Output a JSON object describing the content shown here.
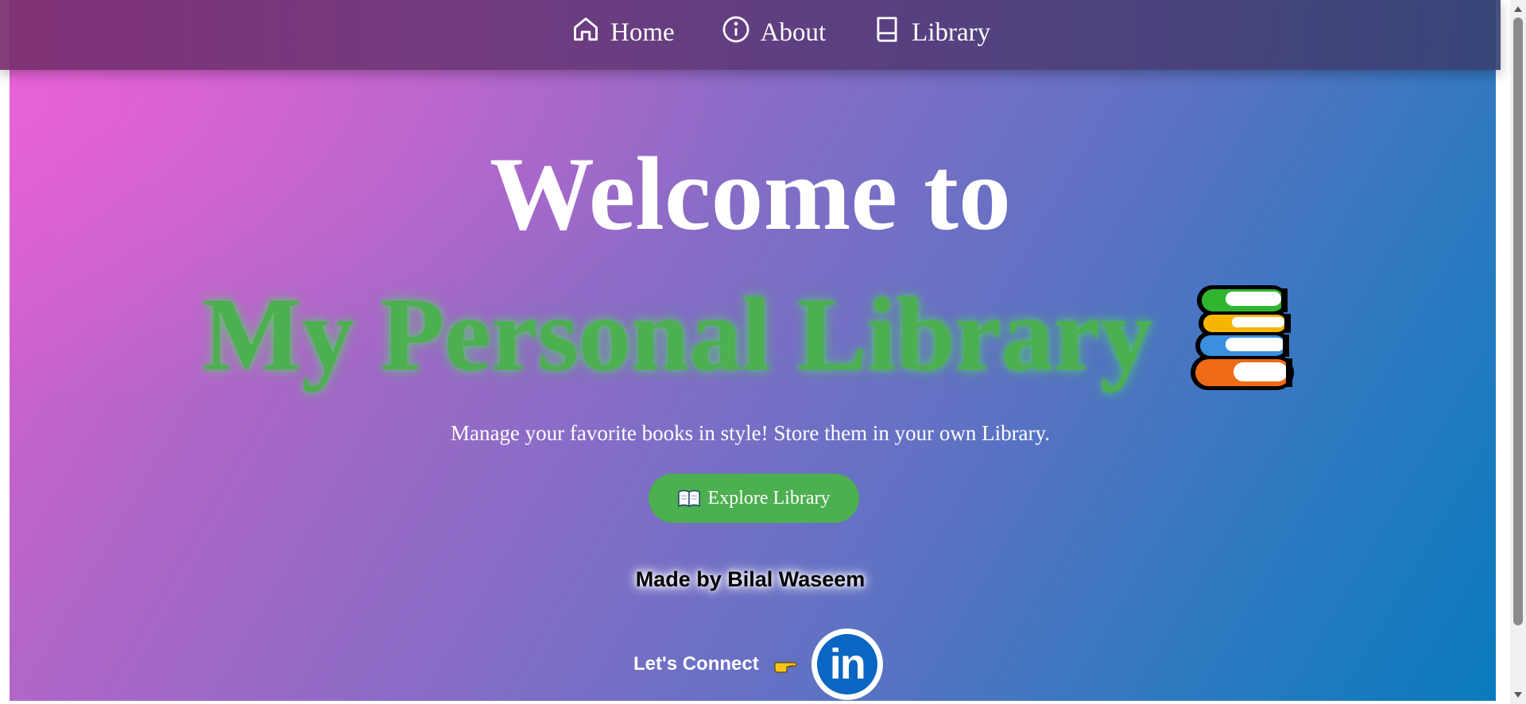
{
  "nav": {
    "items": [
      {
        "label": "Home",
        "icon": "home-icon"
      },
      {
        "label": "About",
        "icon": "info-icon"
      },
      {
        "label": "Library",
        "icon": "book-icon"
      }
    ]
  },
  "hero": {
    "headline": "Welcome to",
    "subheadline": "My Personal Library",
    "tagline": "Manage your favorite books in style! Store them in your own Library.",
    "explore_button_label": "Explore Library",
    "credit": "Made by Bilal Waseem",
    "connect_label": "Let's Connect",
    "linkedin_text": "in"
  },
  "colors": {
    "accent_green": "#4caf50",
    "linkedin_blue": "#0a66c2"
  }
}
